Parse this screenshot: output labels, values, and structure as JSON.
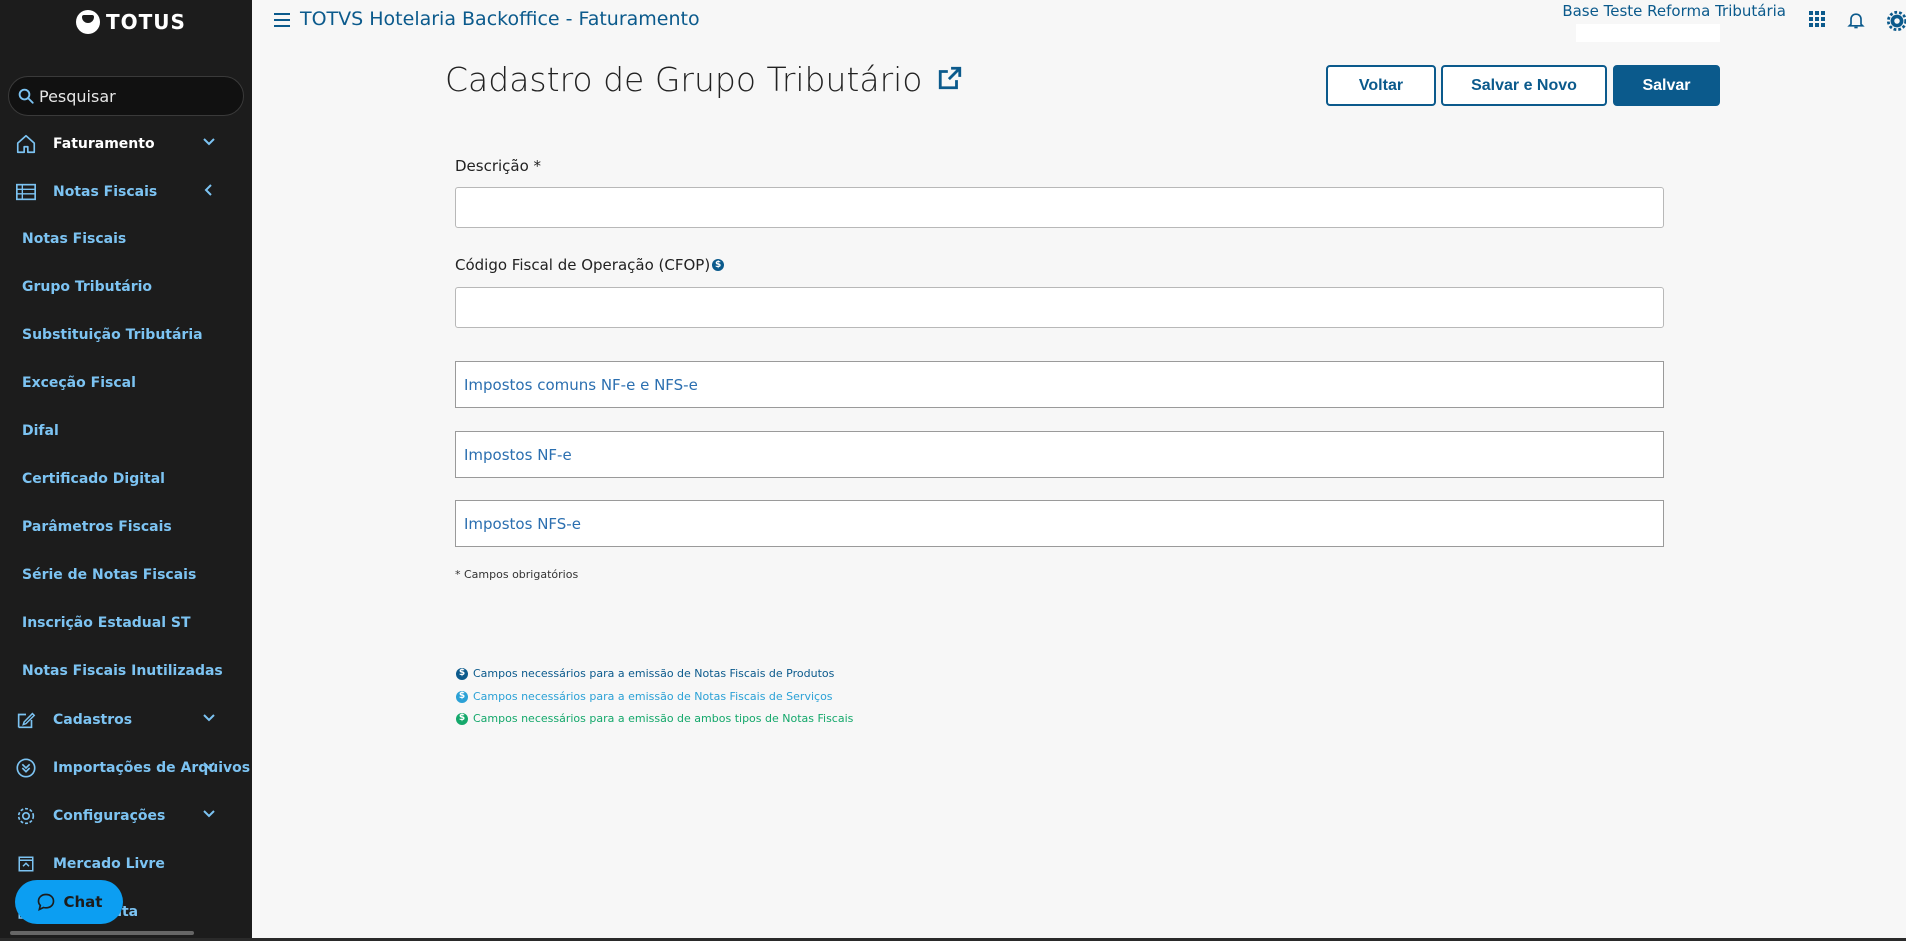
{
  "sidebar": {
    "logo_text": "TOTUS",
    "search_placeholder": "Pesquisar",
    "menu": [
      {
        "label": "Faturamento",
        "icon": "home-icon",
        "chevron": "down"
      },
      {
        "label": "Notas Fiscais",
        "icon": "invoice-list-icon",
        "chevron": "left"
      }
    ],
    "submenu": [
      "Notas Fiscais",
      "Grupo Tributário",
      "Substituição Tributária",
      "Exceção Fiscal",
      "Difal",
      "Certificado Digital",
      "Parâmetros Fiscais",
      "Série de Notas Fiscais",
      "Inscrição Estadual ST",
      "Notas Fiscais Inutilizadas"
    ],
    "lower_menu": [
      {
        "label": "Cadastros",
        "icon": "edit-icon",
        "chevron": "down"
      },
      {
        "label": "Importações de Arquivos",
        "icon": "chevrons-down-circle-icon",
        "chevron": "down"
      },
      {
        "label": "Configurações",
        "icon": "gear-icon",
        "chevron": "down"
      },
      {
        "label": "Mercado Livre",
        "icon": "upload-box-icon",
        "chevron": ""
      }
    ],
    "partial_item_label": "nta",
    "chat_label": "Chat"
  },
  "header": {
    "app_title": "TOTVS Hotelaria Backoffice - Faturamento",
    "tenant": "Base Teste Reforma Tributária"
  },
  "main": {
    "page_title": "Cadastro de Grupo Tributário",
    "buttons": {
      "back": "Voltar",
      "save_new": "Salvar e Novo",
      "save": "Salvar"
    },
    "fields": {
      "descricao_label": "Descrição *",
      "cfop_label": "Código Fiscal de Operação (CFOP)"
    },
    "panels": [
      "Impostos comuns NF-e e NFS-e",
      "Impostos NF-e",
      "Impostos NFS-e"
    ],
    "required_note": "* Campos obrigatórios",
    "legend": [
      {
        "text": "Campos necessários para a emissão de Notas Fiscais de Produtos",
        "color": "#0b5a8c"
      },
      {
        "text": "Campos necessários para a emissão de Notas Fiscais de Serviços",
        "color": "#2ba1d6"
      },
      {
        "text": "Campos necessários para a emissão de ambos tipos de Notas Fiscais",
        "color": "#14a86b"
      }
    ]
  },
  "colors": {
    "primary": "#0b5a8c",
    "sidebar_bg": "#1c1c1c",
    "sidebar_link": "#7cc3f2",
    "chat": "#0c9ef2"
  }
}
